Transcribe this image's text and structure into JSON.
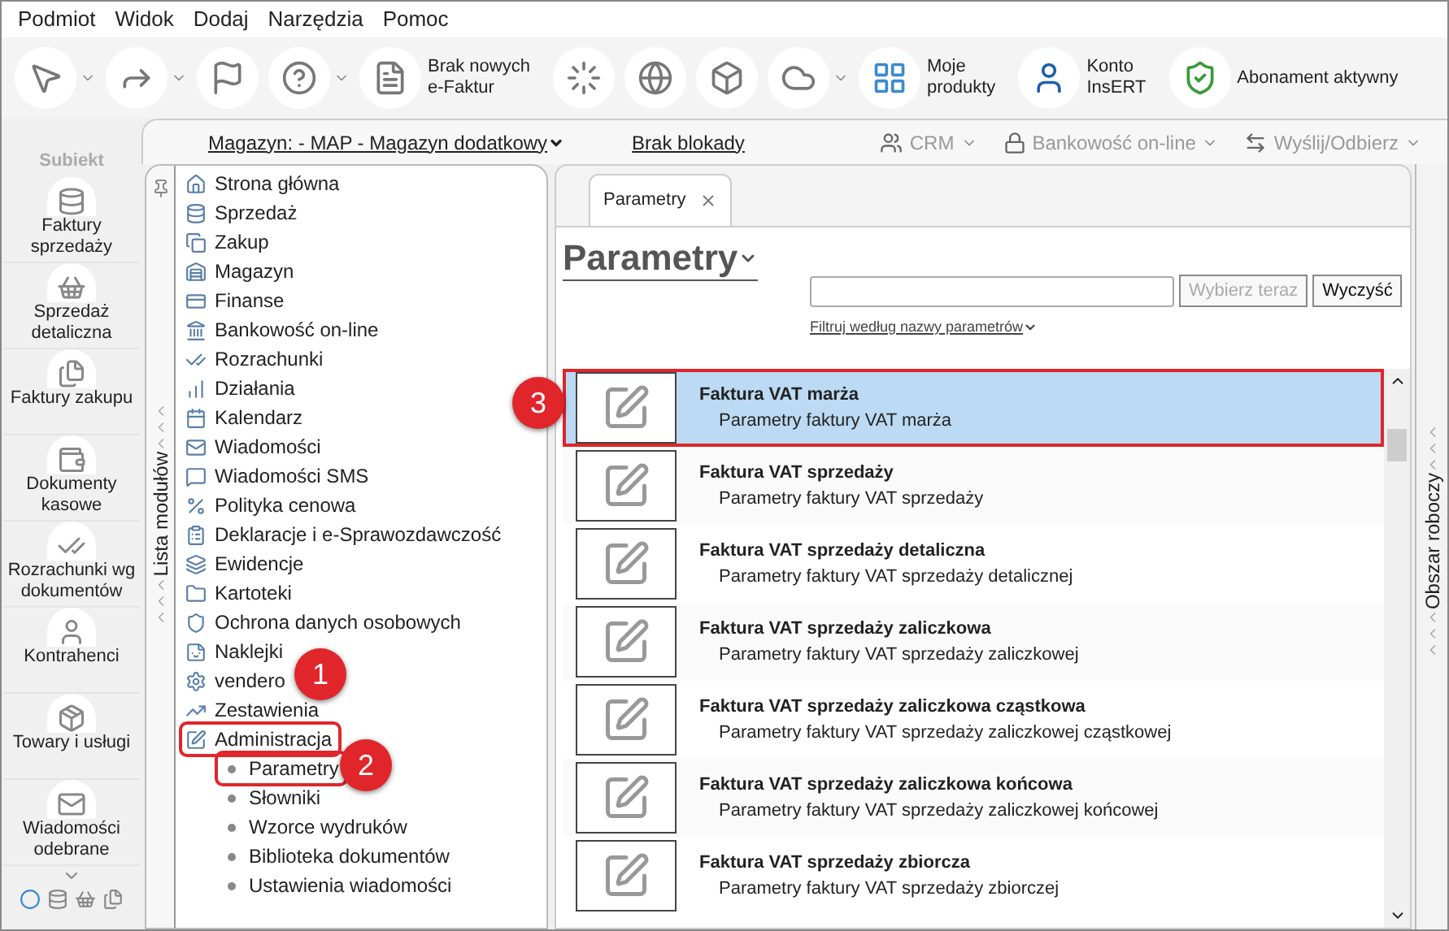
{
  "menu": [
    "Podmiot",
    "Widok",
    "Dodaj",
    "Narzędzia",
    "Pomoc"
  ],
  "toolbar": [
    {
      "kind": "icon",
      "dropdown": true
    },
    {
      "kind": "icon",
      "dropdown": true
    },
    {
      "kind": "icon",
      "dropdown": false
    },
    {
      "kind": "icon",
      "dropdown": true
    },
    {
      "kind": "labeled",
      "lines": [
        "Brak nowych",
        "e-Faktur"
      ]
    },
    {
      "kind": "icon",
      "dropdown": false
    },
    {
      "kind": "icon",
      "dropdown": false
    },
    {
      "kind": "icon",
      "dropdown": false
    },
    {
      "kind": "icon",
      "dropdown": true
    },
    {
      "kind": "labeled",
      "lines": [
        "Moje",
        "produkty"
      ]
    },
    {
      "kind": "labeled",
      "lines": [
        "Konto",
        "InsERT"
      ]
    },
    {
      "kind": "labeled",
      "lines": [
        "Abonament aktywny"
      ]
    }
  ],
  "subbar": {
    "warehouse": "Magazyn: - MAP - Magazyn dodatkowy",
    "lock": "Brak blokady",
    "actions": [
      {
        "label": "CRM",
        "disabled": true
      },
      {
        "label": "Bankowość on-line",
        "disabled": true
      },
      {
        "label": "Wyślij/Odbierz",
        "disabled": true
      }
    ]
  },
  "sidebar": {
    "logo": "Subiekt",
    "items": [
      "Faktury sprzedaży",
      "Sprzedaż detaliczna",
      "Faktury zakupu",
      "Dokumenty kasowe",
      "Rozrachunki wg dokumentów",
      "Kontrahenci",
      "Towary i usługi",
      "Wiadomości odebrane"
    ]
  },
  "modules": {
    "title": "Lista modułów",
    "items": [
      {
        "label": "Strona główna",
        "highlighted": false
      },
      {
        "label": "Sprzedaż",
        "highlighted": false
      },
      {
        "label": "Zakup",
        "highlighted": false
      },
      {
        "label": "Magazyn",
        "highlighted": false
      },
      {
        "label": "Finanse",
        "highlighted": false
      },
      {
        "label": "Bankowość on-line",
        "highlighted": false
      },
      {
        "label": "Rozrachunki",
        "highlighted": false
      },
      {
        "label": "Działania",
        "highlighted": false
      },
      {
        "label": "Kalendarz",
        "highlighted": false
      },
      {
        "label": "Wiadomości",
        "highlighted": false
      },
      {
        "label": "Wiadomości SMS",
        "highlighted": false
      },
      {
        "label": "Polityka cenowa",
        "highlighted": false
      },
      {
        "label": "Deklaracje i e-Sprawozdawczość",
        "highlighted": false
      },
      {
        "label": "Ewidencje",
        "highlighted": false
      },
      {
        "label": "Kartoteki",
        "highlighted": false
      },
      {
        "label": "Ochrona danych osobowych",
        "highlighted": false
      },
      {
        "label": "Naklejki",
        "highlighted": false
      },
      {
        "label": "vendero",
        "highlighted": false
      },
      {
        "label": "Zestawienia",
        "highlighted": false
      },
      {
        "label": "Administracja",
        "highlighted": true,
        "children": [
          {
            "label": "Parametry",
            "highlighted": true
          },
          {
            "label": "Słowniki",
            "highlighted": false
          },
          {
            "label": "Wzorce wydruków",
            "highlighted": false
          },
          {
            "label": "Biblioteka dokumentów",
            "highlighted": false
          },
          {
            "label": "Ustawienia wiadomości",
            "highlighted": false
          }
        ]
      }
    ]
  },
  "tabs": [
    {
      "label": "Parametry",
      "selected": true
    }
  ],
  "content": {
    "title": "Parametry",
    "buttons": [
      {
        "label": "Wybierz teraz",
        "disabled": true
      },
      {
        "label": "Wyczyść",
        "disabled": false
      }
    ],
    "filter": "Filtruj według nazwy parametrów",
    "rows": [
      {
        "title": "Faktura VAT marża",
        "description": "Parametry faktury VAT marża",
        "selected": true,
        "highlighted": true
      },
      {
        "title": "Faktura VAT sprzedaży",
        "description": "Parametry faktury VAT sprzedaży",
        "selected": false,
        "highlighted": false
      },
      {
        "title": "Faktura VAT sprzedaży detaliczna",
        "description": "Parametry faktury VAT sprzedaży detalicznej",
        "selected": false,
        "highlighted": false
      },
      {
        "title": "Faktura VAT sprzedaży zaliczkowa",
        "description": "Parametry faktury VAT sprzedaży zaliczkowej",
        "selected": false,
        "highlighted": false
      },
      {
        "title": "Faktura VAT sprzedaży zaliczkowa cząstkowa",
        "description": "Parametry faktury VAT sprzedaży zaliczkowej cząstkowej",
        "selected": false,
        "highlighted": false
      },
      {
        "title": "Faktura VAT sprzedaży zaliczkowa końcowa",
        "description": "Parametry faktury VAT sprzedaży zaliczkowej końcowej",
        "selected": false,
        "highlighted": false
      },
      {
        "title": "Faktura VAT sprzedaży zbiorcza",
        "description": "Parametry faktury VAT sprzedaży zbiorczej",
        "selected": false,
        "highlighted": false
      }
    ]
  },
  "workspace": {
    "title": "Obszar roboczy"
  },
  "callouts": [
    "1",
    "2",
    "3"
  ]
}
